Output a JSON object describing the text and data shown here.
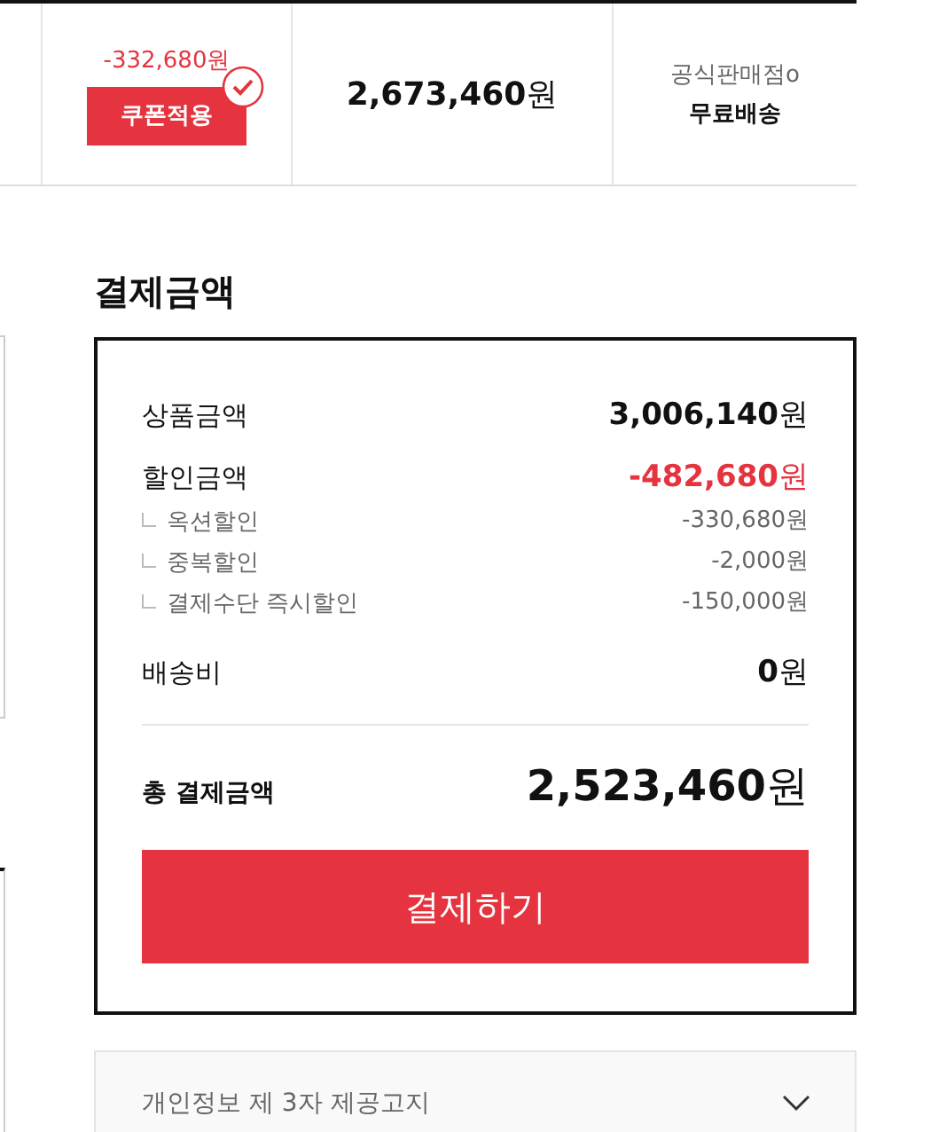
{
  "product_row": {
    "coupon": {
      "discount": "-332,680원",
      "button": "쿠폰적용",
      "applied": true
    },
    "price": "2,673,460",
    "price_unit": "원",
    "seller": {
      "label": "공식판매점o",
      "shipping": "무료배송"
    }
  },
  "payment": {
    "title": "결제금액",
    "rows": [
      {
        "kind": "main",
        "label": "상품금액",
        "amount": "3,006,140",
        "unit": "원",
        "highlight": false
      },
      {
        "kind": "main",
        "label": "할인금액",
        "amount": "-482,680",
        "unit": "원",
        "highlight": true
      },
      {
        "kind": "sub",
        "label": "옥션할인",
        "amount": "-330,680원"
      },
      {
        "kind": "sub",
        "label": "중복할인",
        "amount": "-2,000원"
      },
      {
        "kind": "sub",
        "label": "결제수단 즉시할인",
        "amount": "-150,000원"
      },
      {
        "kind": "main",
        "label": "배송비",
        "amount": "0",
        "unit": "원",
        "highlight": false
      }
    ],
    "total": {
      "label": "총 결제금액",
      "amount": "2,523,460",
      "unit": "원"
    },
    "pay_button": "결제하기"
  },
  "notice": {
    "title": "개인정보 제 3자 제공고지",
    "expanded": false
  }
}
